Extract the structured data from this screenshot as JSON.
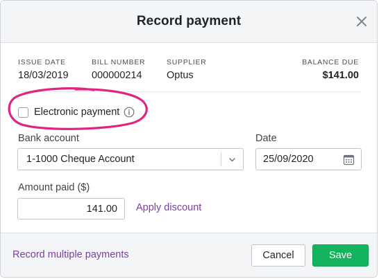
{
  "dialog": {
    "title": "Record payment"
  },
  "bill_info": {
    "issue_date_label": "ISSUE DATE",
    "issue_date": "18/03/2019",
    "bill_number_label": "BILL NUMBER",
    "bill_number": "000000214",
    "supplier_label": "SUPPLIER",
    "supplier": "Optus",
    "balance_due_label": "BALANCE DUE",
    "balance_due": "$141.00"
  },
  "form": {
    "electronic_payment_label": "Electronic payment",
    "electronic_payment_checked": false,
    "bank_account_label": "Bank account",
    "bank_account_value": "1-1000 Cheque Account",
    "date_label": "Date",
    "date_value": "25/09/2020",
    "amount_label": "Amount paid ($)",
    "amount_value": "141.00",
    "apply_discount_label": "Apply discount"
  },
  "footer": {
    "record_multiple_label": "Record multiple payments",
    "cancel_label": "Cancel",
    "save_label": "Save"
  },
  "icons": {
    "close": "close-icon",
    "info": "info-icon",
    "dropdown": "chevron-down-icon",
    "calendar": "calendar-icon"
  },
  "colors": {
    "link": "#7b3fa0",
    "save_button": "#14b35d",
    "annotation_circle": "#e0247f"
  }
}
